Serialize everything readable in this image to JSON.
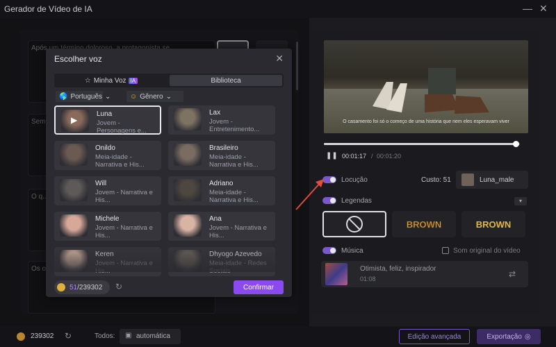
{
  "window": {
    "title": "Gerador de Vídeo de IA",
    "minimize": "—",
    "close": "✕"
  },
  "left": {
    "scripts": [
      "Após um término doloroso, a protagonista se...",
      "Sem...",
      "O q...",
      "Os o..."
    ]
  },
  "preview": {
    "caption": "O casamento foi só o começo de uma história que nem eles esperavam viver",
    "time_current": "00:01:17",
    "time_separator": "/",
    "time_total": "00:01:20",
    "progress": 0.98
  },
  "settings": {
    "locucao_label": "Locução",
    "cost_label": "Custo: 51",
    "voice_selected": "Luna_male",
    "legendas_label": "Legendas",
    "styles": [
      "",
      "BROWN",
      "BROWN"
    ],
    "musica_label": "Música",
    "som_original_label": "Som original do vídeo",
    "music_title": "Otimista, feliz, inspirador",
    "music_duration": "01:08"
  },
  "bottom": {
    "credits": "239302",
    "todos_label": "Todos:",
    "auto_label": "automática",
    "advanced_label": "Edição avançada",
    "export_label": "Exportação"
  },
  "modal": {
    "title": "Escolher voz",
    "tab_my_voice": "Minha Voz",
    "tab_badge": "IA",
    "tab_library": "Biblioteca",
    "filter_language": "Português",
    "filter_gender": "Gênero",
    "voices": [
      {
        "name": "Luna",
        "desc": "Jovem - Personagens e...",
        "color": "#8a6a5a"
      },
      {
        "name": "Lax",
        "desc": "Jovem - Entretenimento...",
        "color": "#7e7262"
      },
      {
        "name": "Onildo",
        "desc": "Meia-idade - Narrativa e His...",
        "color": "#6a5a52"
      },
      {
        "name": "Brasileiro",
        "desc": "Meia-idade - Narrativa e His...",
        "color": "#7a6c60"
      },
      {
        "name": "Will",
        "desc": "Jovem - Narrativa e His...",
        "color": "#5e5a58"
      },
      {
        "name": "Adriano",
        "desc": "Meia-idade - Narrativa e His...",
        "color": "#4e4640"
      },
      {
        "name": "Michele",
        "desc": "Jovem - Narrativa e His...",
        "color": "#d7a89a"
      },
      {
        "name": "Ana",
        "desc": "Jovem - Narrativa e His...",
        "color": "#d9b3a4"
      },
      {
        "name": "Keren",
        "desc": "Jovem - Narrativa e His...",
        "color": "#d9b7a6"
      },
      {
        "name": "Dhyogo Azevedo",
        "desc": "Meia-idade - Redes Sociais",
        "color": "#6e665e"
      }
    ],
    "credits_used": "51",
    "credits_total": "/239302",
    "confirm_label": "Confirmar"
  }
}
